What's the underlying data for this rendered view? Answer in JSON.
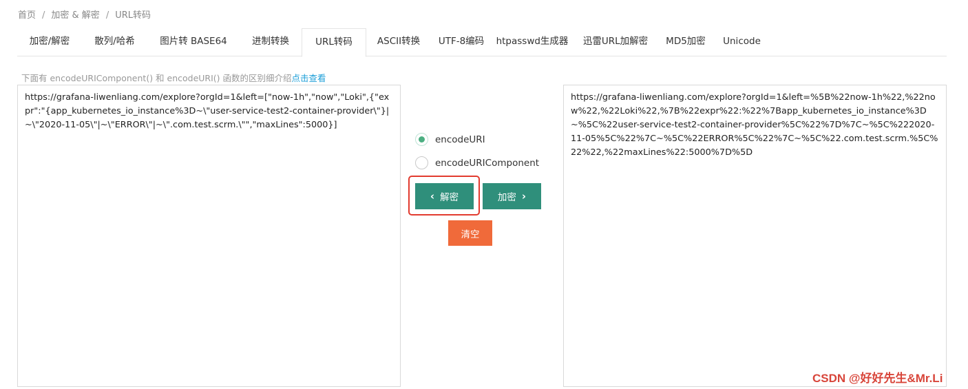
{
  "breadcrumb": {
    "items": [
      "首页",
      "加密 & 解密",
      "URL转码"
    ],
    "separator": "/"
  },
  "tabs": [
    {
      "label": "加密/解密",
      "active": false
    },
    {
      "label": "散列/哈希",
      "active": false
    },
    {
      "label": "图片转 BASE64",
      "active": false
    },
    {
      "label": "进制转换",
      "active": false
    },
    {
      "label": "URL转码",
      "active": true
    },
    {
      "label": "ASCII转换",
      "active": false
    },
    {
      "label": "UTF-8编码",
      "active": false
    },
    {
      "label": "htpasswd生成器",
      "active": false
    },
    {
      "label": "迅雷URL加解密",
      "active": false
    },
    {
      "label": "MD5加密",
      "active": false
    },
    {
      "label": "Unicode",
      "active": false
    }
  ],
  "hint": {
    "text": "下面有 encodeURIComponent() 和 encodeURI() 函数的区别细介绍",
    "link": "点击查看"
  },
  "input_text": "https://grafana-liwenliang.com/explore?orgId=1&left=[\"now-1h\",\"now\",\"Loki\",{\"expr\":\"{app_kubernetes_io_instance%3D~\\\"user-service-test2-container-provider\\\"}|~\\\"2020-11-05\\\"|~\\\"ERROR\\\"|~\\\".com.test.scrm.\\\"\",\"maxLines\":5000}]",
  "output_text": "https://grafana-liwenliang.com/explore?orgId=1&left=%5B%22now-1h%22,%22now%22,%22Loki%22,%7B%22expr%22:%22%7Bapp_kubernetes_io_instance%3D~%5C%22user-service-test2-container-provider%5C%22%7D%7C~%5C%222020-11-05%5C%22%7C~%5C%22ERROR%5C%22%7C~%5C%22.com.test.scrm.%5C%22%22,%22maxLines%22:5000%7D%5D",
  "options": {
    "encode_uri": {
      "label": "encodeURI",
      "checked": true
    },
    "encode_uri_component": {
      "label": "encodeURIComponent",
      "checked": false
    }
  },
  "buttons": {
    "decode": "解密",
    "encode": "加密",
    "clear": "清空"
  },
  "watermark": "CSDN @好好先生&Mr.Li",
  "colors": {
    "accent_green": "#2f8f7b",
    "clear_orange": "#f06a3a",
    "highlight_red": "#e23a2e",
    "link_blue": "#1e9fd8"
  }
}
